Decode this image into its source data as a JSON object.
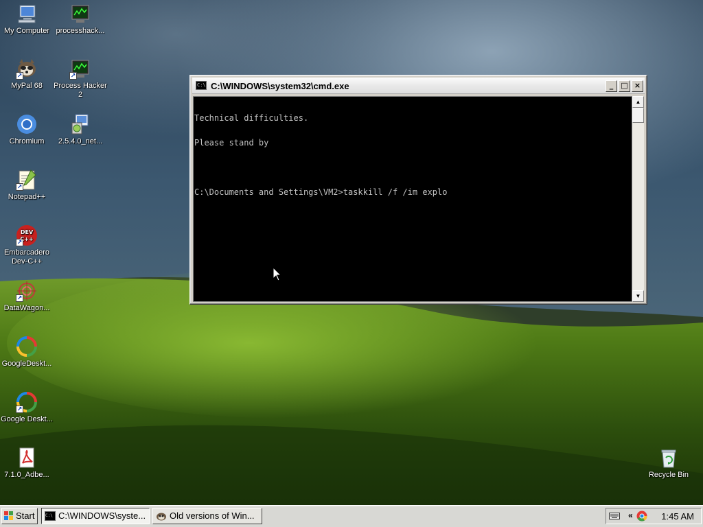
{
  "desktop": {
    "icons": [
      {
        "label": "My Computer",
        "icon": "my-computer-icon",
        "shortcut": false
      },
      {
        "label": "processhack...",
        "icon": "process-hacker-icon",
        "shortcut": false
      },
      {
        "label": "MyPal 68",
        "icon": "mypal-icon",
        "shortcut": true
      },
      {
        "label": "Process Hacker 2",
        "icon": "process-hacker-icon",
        "shortcut": true
      },
      {
        "label": "Chromium",
        "icon": "chromium-icon",
        "shortcut": false
      },
      {
        "label": "2.5.4.0_net...",
        "icon": "installer-icon",
        "shortcut": false
      },
      {
        "label": "Notepad++",
        "icon": "notepad-plus-plus-icon",
        "shortcut": true
      },
      {
        "label": "Embarcadero Dev-C++",
        "icon": "dev-cpp-icon",
        "shortcut": true
      },
      {
        "label": "DataWagon...",
        "icon": "datawagon-icon",
        "shortcut": true
      },
      {
        "label": "GoogleDeskt...",
        "icon": "google-desktop-icon",
        "shortcut": false
      },
      {
        "label": "Google Deskt...",
        "icon": "google-desktop-icon",
        "shortcut": true
      },
      {
        "label": "7.1.0_Adbe...",
        "icon": "adobe-reader-icon",
        "shortcut": false
      },
      {
        "label": "Recycle Bin",
        "icon": "recycle-bin-icon",
        "shortcut": false
      }
    ]
  },
  "cmd_window": {
    "title": "C:\\WINDOWS\\system32\\cmd.exe",
    "icon": "cmd-icon",
    "buttons": {
      "minimize": "_",
      "maximize": "□",
      "close": "×"
    },
    "lines": [
      "Technical difficulties.",
      "Please stand by",
      "",
      "C:\\Documents and Settings\\VM2>taskkill /f /im explo"
    ]
  },
  "taskbar": {
    "start_label": "Start",
    "tasks": [
      {
        "label": "C:\\WINDOWS\\syste...",
        "icon": "cmd-icon",
        "active": true
      },
      {
        "label": "Old versions of Win...",
        "icon": "mypal-icon",
        "active": false
      }
    ],
    "tray": {
      "chevron": "«",
      "clock": "1:45 AM"
    }
  }
}
